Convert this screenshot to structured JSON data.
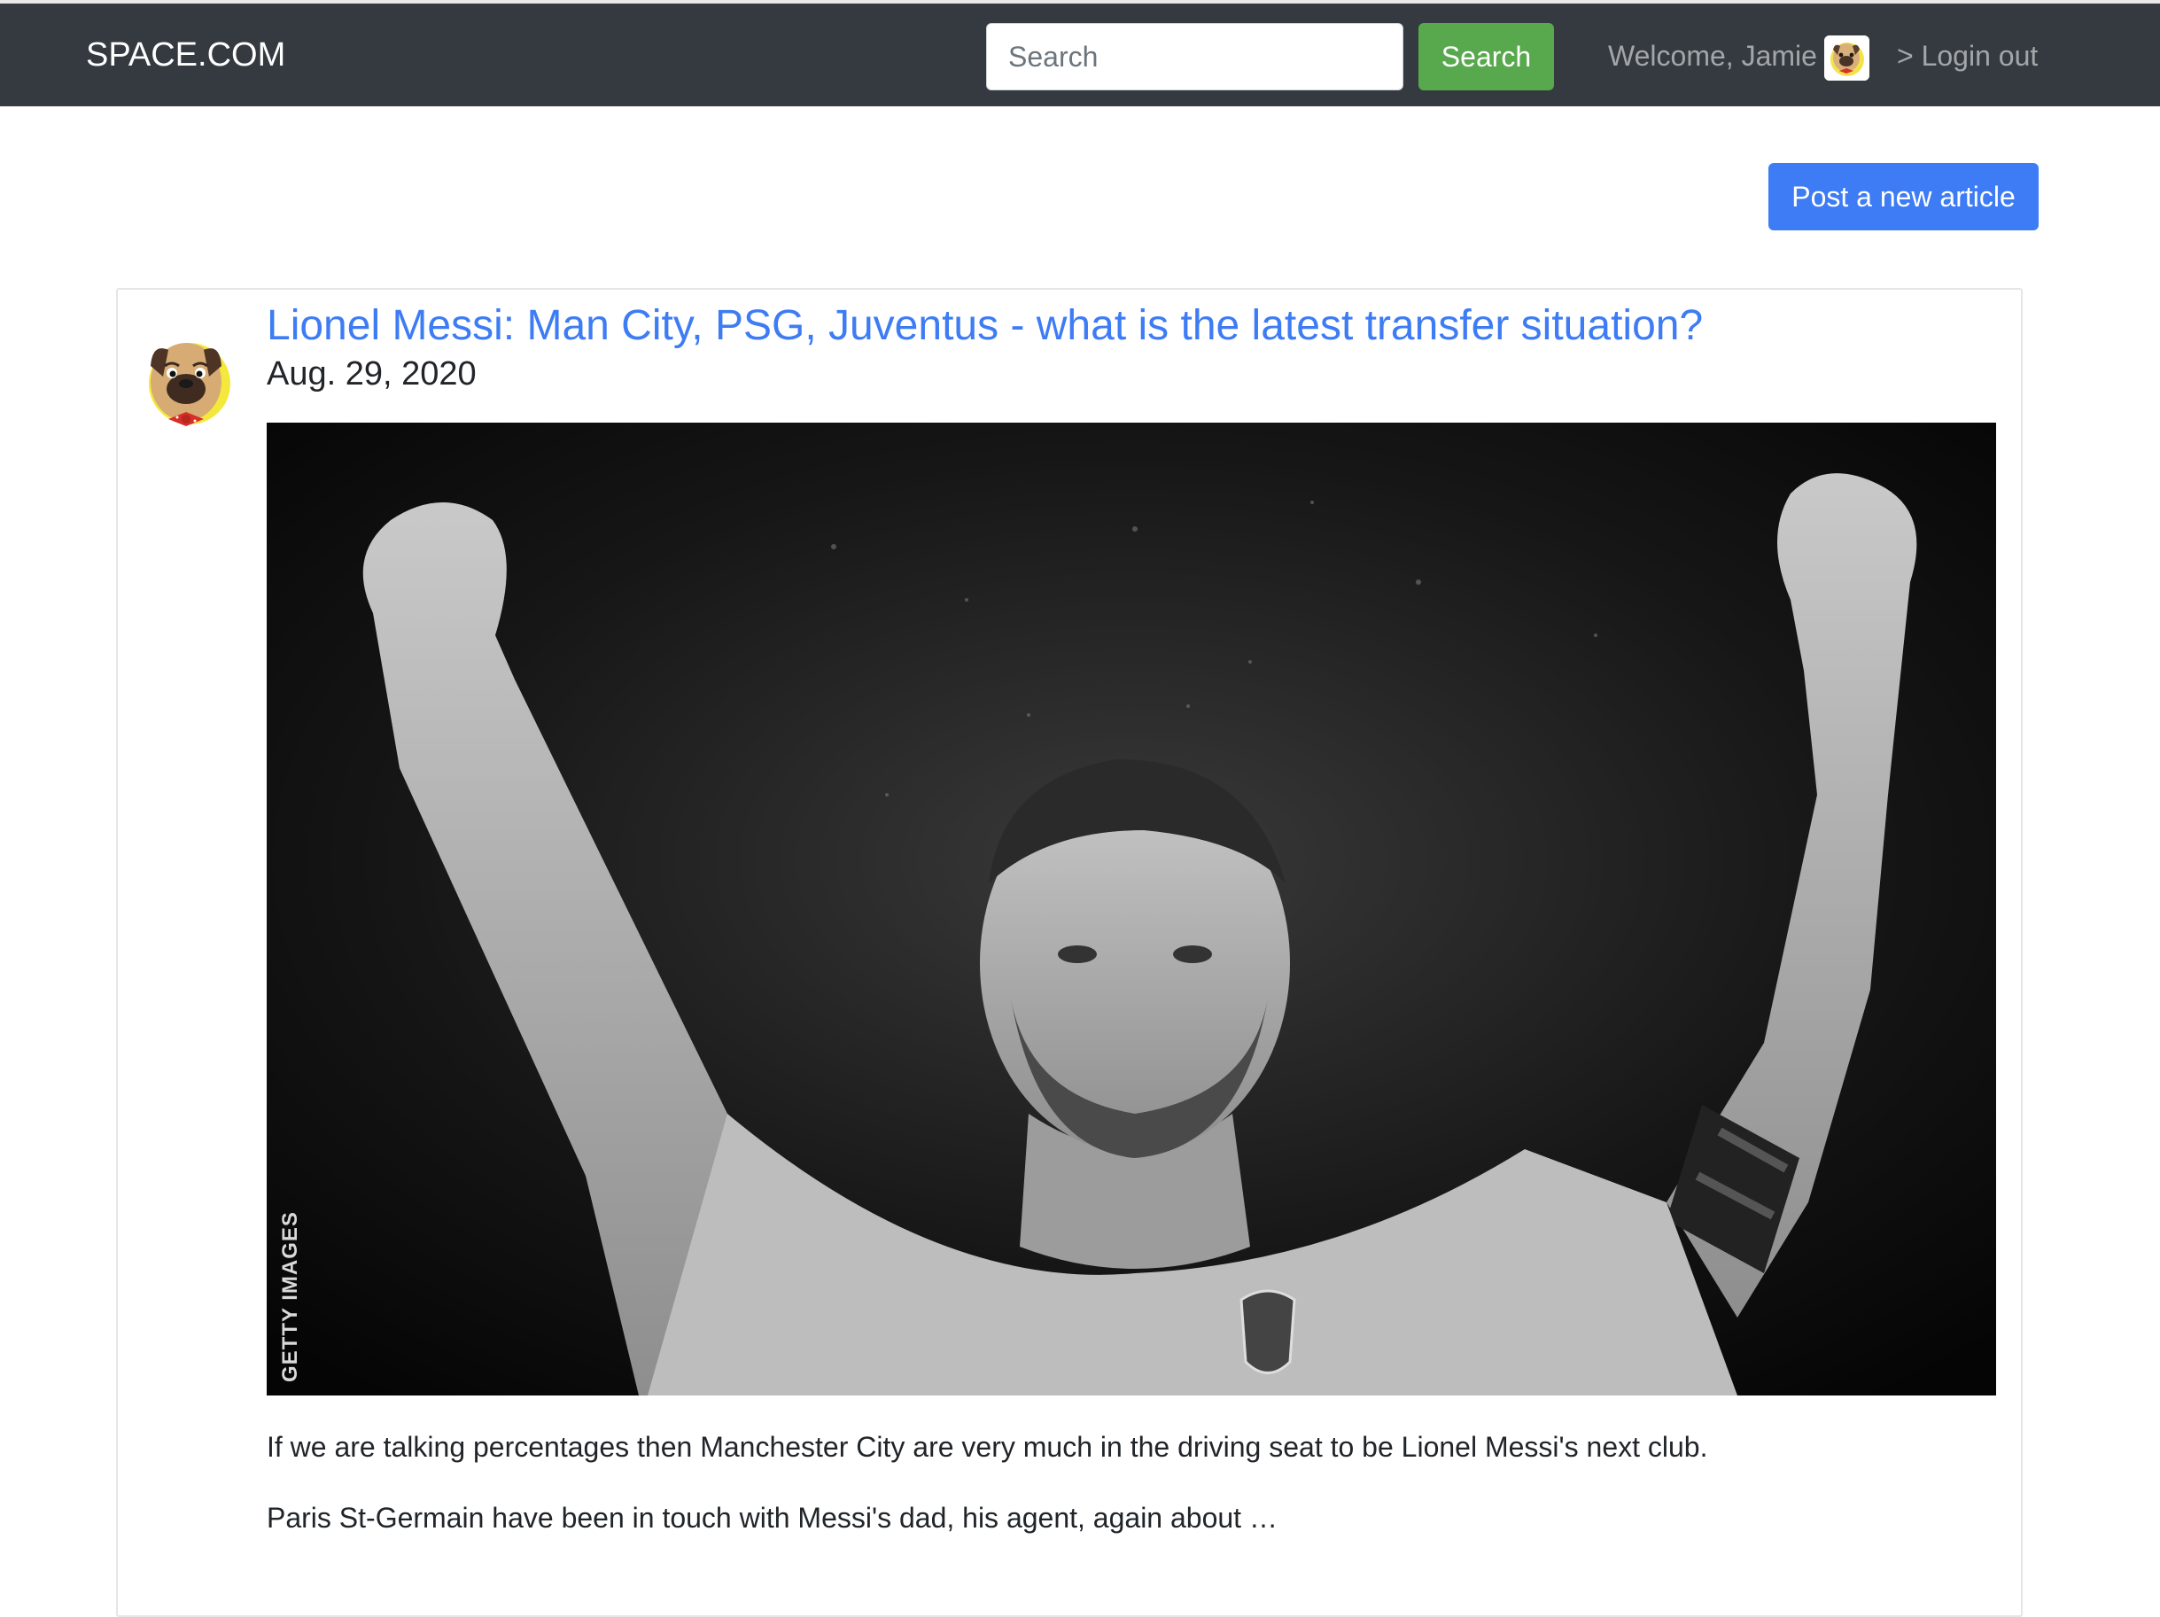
{
  "navbar": {
    "brand": "SPACE.COM",
    "search": {
      "placeholder": "Search",
      "value": ""
    },
    "search_button": "Search",
    "welcome": "Welcome, Jamie",
    "logout": "> Login out"
  },
  "actions": {
    "post_new_article": "Post a new article"
  },
  "article": {
    "title": "Lionel Messi: Man City, PSG, Juventus - what is the latest transfer situation?",
    "date": "Aug. 29, 2020",
    "image_credit": "GETTY IMAGES",
    "paragraphs": [
      "If we are talking percentages then Manchester City are very much in the driving seat to be Lionel Messi's next club.",
      "Paris St-Germain have been in touch with Messi's dad, his agent, again about …"
    ]
  },
  "colors": {
    "navbar_bg": "#343a40",
    "search_button": "#58a84d",
    "primary": "#3d7cf4",
    "link": "#3d7cf4"
  },
  "icons": {
    "user_avatar": "pug-avatar-icon",
    "author_avatar": "pug-avatar-icon"
  }
}
